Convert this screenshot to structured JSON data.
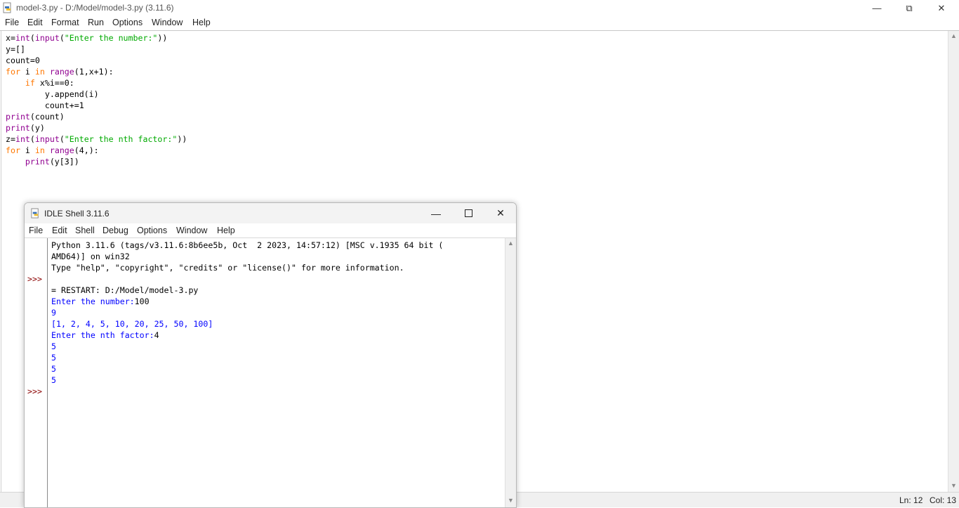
{
  "editor": {
    "title": "model-3.py - D:/Model/model-3.py (3.11.6)",
    "menu": [
      "File",
      "Edit",
      "Format",
      "Run",
      "Options",
      "Window",
      "Help"
    ],
    "window_controls": {
      "minimize": "—",
      "restore": "⧉",
      "close": "✕"
    },
    "code_lines": [
      "x=int(input(\"Enter the number:\"))",
      "y=[]",
      "count=0",
      "for i in range(1,x+1):",
      "    if x%i==0:",
      "        y.append(i)",
      "        count+=1",
      "print(count)",
      "print(y)",
      "z=int(input(\"Enter the nth factor:\"))",
      "for i in range(4,):",
      "    print(y[3])"
    ],
    "status": {
      "line": "Ln: 12",
      "col": "Col: 13"
    }
  },
  "shell": {
    "title": "IDLE Shell 3.11.6",
    "menu": [
      "File",
      "Edit",
      "Shell",
      "Debug",
      "Options",
      "Window",
      "Help"
    ],
    "prompt": ">>>",
    "banner": [
      "Python 3.11.6 (tags/v3.11.6:8b6ee5b, Oct  2 2023, 14:57:12) [MSC v.1935 64 bit (",
      "AMD64)] on win32",
      "Type \"help\", \"copyright\", \"credits\" or \"license()\" for more information."
    ],
    "restart": "= RESTART: D:/Model/model-3.py",
    "output": [
      {
        "prompt_text": "Enter the number:",
        "input": "100"
      },
      {
        "text": "9"
      },
      {
        "text": "[1, 2, 4, 5, 10, 20, 25, 50, 100]"
      },
      {
        "prompt_text": "Enter the nth factor:",
        "input": "4"
      },
      {
        "text": "5"
      },
      {
        "text": "5"
      },
      {
        "text": "5"
      },
      {
        "text": "5"
      }
    ]
  },
  "colors": {
    "keyword": "#ff7700",
    "builtin": "#900090",
    "string": "#00aa00",
    "stdout": "#0000ff",
    "prompt": "#8b0000"
  },
  "icons": [
    "python-file-icon",
    "minimize-icon",
    "maximize-icon",
    "close-icon",
    "scroll-up-icon",
    "scroll-down-icon"
  ]
}
